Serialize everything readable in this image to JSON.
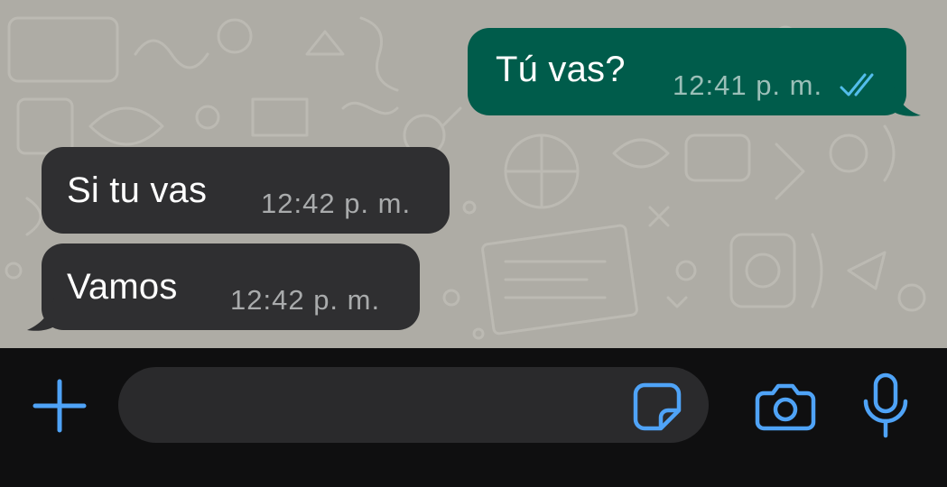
{
  "messages": [
    {
      "direction": "outgoing",
      "text": "Tú vas?",
      "time": "12:41 p. m.",
      "status": "read-double-check"
    },
    {
      "direction": "incoming",
      "text": "Si tu vas",
      "time": "12:42 p. m."
    },
    {
      "direction": "incoming",
      "text": "Vamos",
      "time": "12:42 p. m."
    }
  ],
  "composer": {
    "input_value": "",
    "icons": {
      "attach": "plus-icon",
      "sticker": "sticker-icon",
      "camera": "camera-icon",
      "mic": "microphone-icon"
    }
  },
  "colors": {
    "chat_background": "#aeaca5",
    "outgoing_bubble": "#005c4b",
    "incoming_bubble": "#2f2f31",
    "input_bar": "#0f0f10",
    "input_field": "#2a2a2c",
    "accent_blue": "#4fa3f7",
    "read_tick": "#53bdeb"
  }
}
